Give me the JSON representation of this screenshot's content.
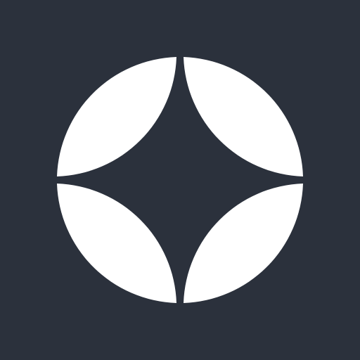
{
  "app_icon": {
    "icon": "four-petal-star-circle-logo",
    "background_color": "#2b313c",
    "foreground_color": "#ffffff"
  }
}
